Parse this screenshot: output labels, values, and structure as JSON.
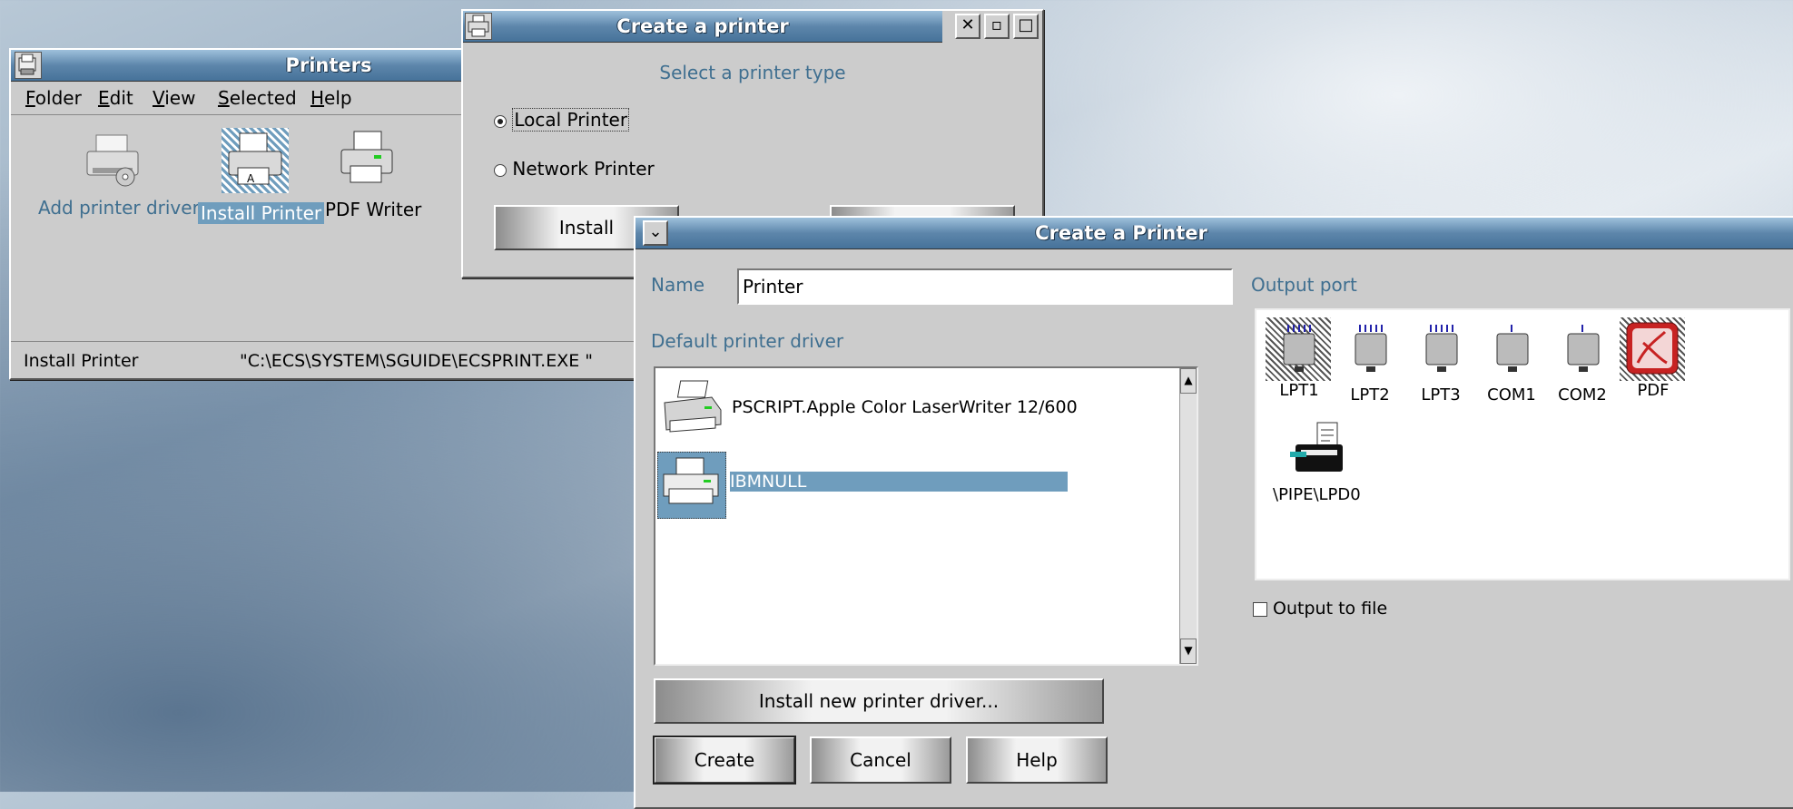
{
  "printers_window": {
    "title": "Printers",
    "menu": [
      "Folder",
      "Edit",
      "View",
      "Selected",
      "Help"
    ],
    "icons": [
      {
        "label": "Add printer drivers",
        "icon": "printer-cd-icon"
      },
      {
        "label": "Install Printer",
        "icon": "printer-icon"
      },
      {
        "label": "PDF Writer",
        "icon": "printer-icon"
      }
    ],
    "status_left": "Install Printer",
    "status_right": "\"C:\\ECS\\SYSTEM\\SGUIDE\\ECSPRINT.EXE \""
  },
  "create_printer_small": {
    "title": "Create a printer",
    "subtitle": "Select a printer type",
    "options": [
      {
        "label": "Local Printer",
        "selected": true
      },
      {
        "label": "Network Printer",
        "selected": false
      }
    ],
    "install_button": "Install"
  },
  "create_printer_dialog": {
    "title": "Create a Printer",
    "name_label": "Name",
    "name_value": "Printer",
    "driver_label": "Default printer driver",
    "drivers": [
      {
        "label": "PSCRIPT.Apple Color LaserWriter 12/600",
        "selected": false
      },
      {
        "label": "IBMNULL",
        "selected": true
      }
    ],
    "port_label": "Output port",
    "ports": [
      "LPT1",
      "LPT2",
      "LPT3",
      "COM1",
      "COM2",
      "PDF",
      "\\PIPE\\LPD0"
    ],
    "output_to_file": "Output to file",
    "install_driver_button": "Install new printer driver...",
    "create_button": "Create",
    "cancel_button": "Cancel",
    "help_button": "Help"
  },
  "colors": {
    "titlebar": "#46729a",
    "selection": "#6f9dbd",
    "label_blue": "#3f6f90",
    "window_bg": "#cccccc"
  }
}
